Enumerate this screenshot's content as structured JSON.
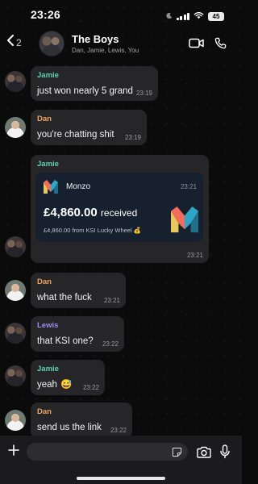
{
  "status_bar": {
    "time": "23:26",
    "battery": "45"
  },
  "header": {
    "back_count": "2",
    "title": "The Boys",
    "members": "Dan, Jamie, Lewis, You"
  },
  "colors": {
    "jamie": "#5fd1a8",
    "dan": "#f0a35e",
    "lewis": "#9b8cf2",
    "bubble": "#262628",
    "monzo_card": "#16202e"
  },
  "messages": [
    {
      "sender": "Jamie",
      "text": "just won nearly 5 grand",
      "time": "23:19"
    },
    {
      "sender": "Dan",
      "text": "you're chatting shit",
      "time": "23:19"
    },
    {
      "sender": "Jamie",
      "time": "23:21",
      "payment": {
        "brand": "Monzo",
        "time": "23:21",
        "amount": "£4,860.00",
        "status": "received",
        "description": "£4,860.00 from KSI Lucky Wheel 💰"
      }
    },
    {
      "sender": "Dan",
      "text": "what the fuck",
      "time": "23:21"
    },
    {
      "sender": "Lewis",
      "text": "that KSI one?",
      "time": "23:22"
    },
    {
      "sender": "Jamie",
      "text": "yeah",
      "emoji": "😅",
      "time": "23:22"
    },
    {
      "sender": "Dan",
      "text": "send us the link",
      "time": "23:22"
    }
  ],
  "composer": {
    "placeholder": ""
  },
  "icons": {
    "back": "chevron-left-icon",
    "video": "video-camera-icon",
    "phone": "phone-icon",
    "add": "plus-icon",
    "sticker": "sticker-icon",
    "camera": "camera-icon",
    "mic": "microphone-icon"
  }
}
